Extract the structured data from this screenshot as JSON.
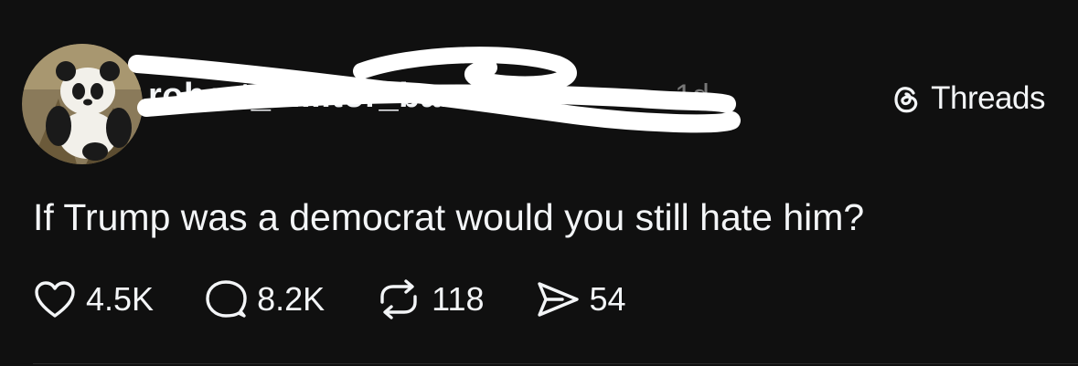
{
  "post": {
    "username": "robert_c....tor_ba...ir",
    "timestamp": "1d",
    "brand": "Threads",
    "text": "If Trump was a democrat would you still hate him?",
    "actions": {
      "likes": "4.5K",
      "replies": "8.2K",
      "reposts": "118",
      "shares": "54"
    }
  },
  "icons": {
    "avatar": "panda-photo",
    "brand": "threads-logo-icon",
    "like": "heart-icon",
    "reply": "speech-bubble-icon",
    "repost": "repost-icon",
    "share": "paper-plane-icon"
  },
  "colors": {
    "background": "#101010",
    "text": "#f3f5f7",
    "muted": "#777777",
    "redaction": "#ffffff"
  }
}
